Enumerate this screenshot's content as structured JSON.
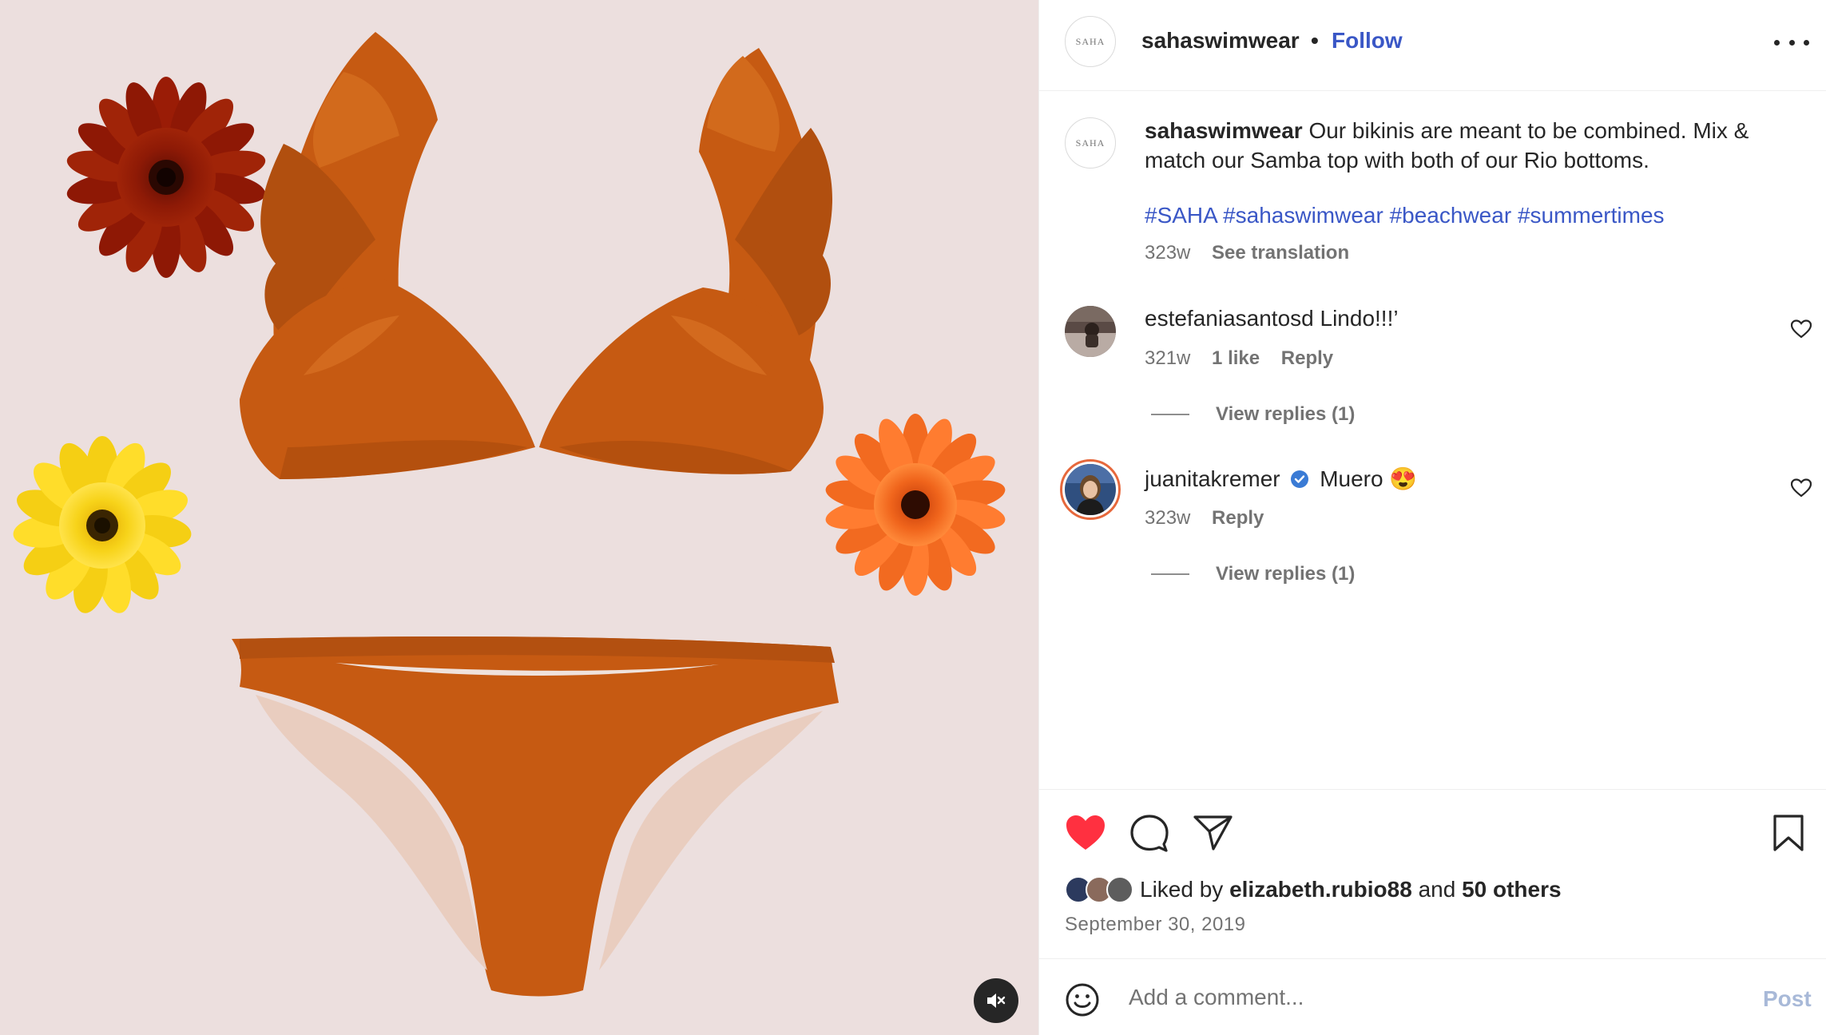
{
  "post": {
    "username": "sahaswimwear",
    "separator": "•",
    "follow_label": "Follow",
    "avatar_text": "SAHA",
    "caption_user": "sahaswimwear",
    "caption_text": "Our bikinis are meant to be combined. Mix & match our Samba top with both of our Rio bottoms.",
    "hashtags": [
      "#SAHA",
      "#sahaswimwear",
      "#beachwear",
      "#summertimes"
    ],
    "caption_age": "323w",
    "see_translation": "See translation"
  },
  "comments": [
    {
      "username": "estefaniasantosd",
      "text": "Lindo!!!’",
      "age": "321w",
      "likes": "1 like",
      "reply_label": "Reply",
      "view_replies": "View replies (1)",
      "verified": false
    },
    {
      "username": "juanitakremer",
      "text": "Muero",
      "emoji": "😍",
      "age": "323w",
      "reply_label": "Reply",
      "view_replies": "View replies (1)",
      "verified": true
    }
  ],
  "likes": {
    "prefix": "Liked by",
    "user": "elizabeth.rubio88",
    "middle": "and",
    "others": "50 others"
  },
  "date": "September 30, 2019",
  "comment_box": {
    "placeholder": "Add a comment...",
    "post_label": "Post"
  },
  "colors": {
    "accent": "#3a57c6",
    "heart": "#ff3040",
    "media_bg": "#ecdfde",
    "bikini": "#c45e14"
  },
  "icons": [
    "more-icon",
    "heart-icon",
    "comment-icon",
    "share-icon",
    "bookmark-icon",
    "emoji-icon",
    "mute-icon",
    "verified-icon"
  ]
}
